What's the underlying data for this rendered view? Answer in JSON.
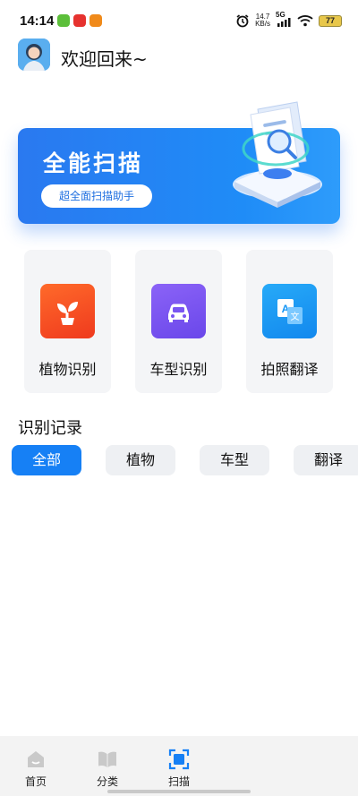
{
  "status_bar": {
    "time": "14:14",
    "net_speed_value": "14.7",
    "net_speed_unit": "KB/s",
    "network": "5G",
    "battery": "77"
  },
  "header": {
    "greeting": "欢迎回来~"
  },
  "banner": {
    "title": "全能扫描",
    "button_label": "超全面扫描助手"
  },
  "features": [
    {
      "label": "植物识别",
      "icon": "plant-icon",
      "color": "#fa4d22"
    },
    {
      "label": "车型识别",
      "icon": "car-icon",
      "color": "#7a56f2"
    },
    {
      "label": "拍照翻译",
      "icon": "translate-icon",
      "color": "#1996f5"
    }
  ],
  "records": {
    "title": "识别记录",
    "filters": [
      "全部",
      "植物",
      "车型",
      "翻译"
    ],
    "active_filter": "全部"
  },
  "bottom_nav": {
    "items": [
      {
        "label": "首页",
        "icon": "home-icon"
      },
      {
        "label": "分类",
        "icon": "book-icon"
      },
      {
        "label": "扫描",
        "icon": "scan-icon",
        "active": true
      }
    ]
  },
  "colors": {
    "accent": "#1680f5",
    "banner": "#2a79f0"
  }
}
